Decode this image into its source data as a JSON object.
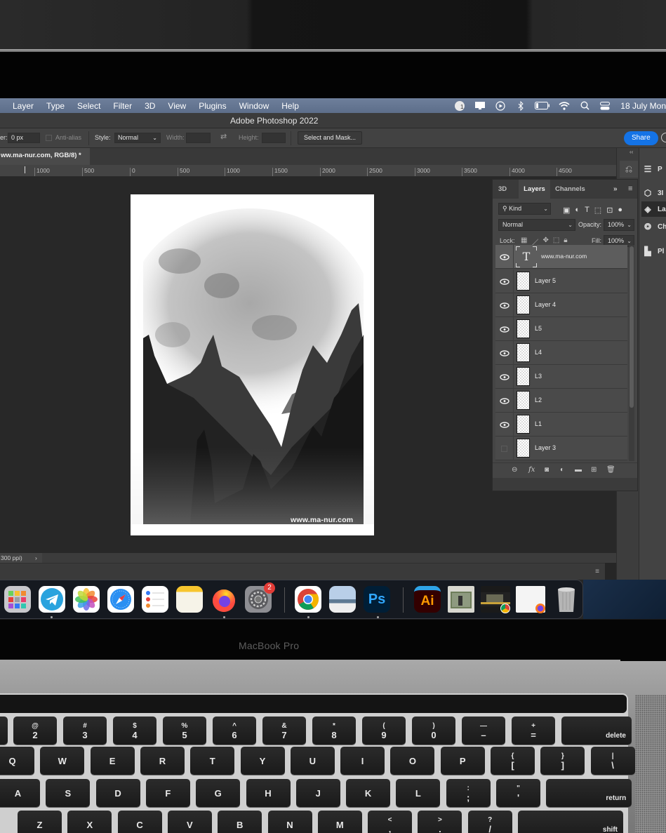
{
  "menubar": {
    "items": [
      "Layer",
      "Type",
      "Select",
      "Filter",
      "3D",
      "View",
      "Plugins",
      "Window",
      "Help"
    ],
    "status_icons": [
      "notification-badge-icon",
      "display-icon",
      "play-icon",
      "bluetooth-icon",
      "battery-icon",
      "wifi-icon",
      "search-icon",
      "control-center-icon"
    ],
    "notification_count": "1",
    "date": "18 July Mon"
  },
  "app": {
    "title": "Adobe Photoshop 2022"
  },
  "options_bar": {
    "feather_label": "er:",
    "feather_value": "0 px",
    "antialias_label": "Anti-alias",
    "style_label": "Style:",
    "style_value": "Normal",
    "width_label": "Width:",
    "height_label": "Height:",
    "select_mask_label": "Select and Mask...",
    "share_label": "Share"
  },
  "document_tab": {
    "label": "ww.ma-nur.com, RGB/8) *"
  },
  "ruler": {
    "ticks": [
      "1000",
      "500",
      "0",
      "500",
      "1000",
      "1500",
      "2000",
      "2500",
      "3000",
      "3500",
      "4000",
      "4500"
    ]
  },
  "canvas": {
    "watermark": "www.ma-nur.com"
  },
  "status_bar": {
    "text": "300 ppi)",
    "arrow": "›"
  },
  "right_dock": {
    "items": [
      {
        "label": "P",
        "icon": "properties-icon"
      },
      {
        "label": "3I",
        "icon": "3d-cube-icon"
      },
      {
        "label": "La",
        "icon": "layers-icon"
      },
      {
        "label": "Ch",
        "icon": "channels-icon"
      },
      {
        "label": "Pl",
        "icon": "plugins-icon"
      }
    ]
  },
  "layers_panel": {
    "tabs": [
      "3D",
      "Layers",
      "Channels"
    ],
    "active_tab": "Layers",
    "filter_kind": "Kind",
    "blend_mode": "Normal",
    "opacity_label": "Opacity:",
    "opacity_value": "100%",
    "lock_label": "Lock:",
    "fill_label": "Fill:",
    "fill_value": "100%",
    "layers": [
      {
        "name": "www.ma-nur.com",
        "type": "text",
        "visible": true,
        "selected": true
      },
      {
        "name": "Layer 5",
        "type": "pixel",
        "visible": true,
        "selected": false
      },
      {
        "name": "Layer 4",
        "type": "pixel",
        "visible": true,
        "selected": false
      },
      {
        "name": "L5",
        "type": "pixel",
        "visible": true,
        "selected": false
      },
      {
        "name": "L4",
        "type": "pixel",
        "visible": true,
        "selected": false
      },
      {
        "name": "L3",
        "type": "pixel",
        "visible": true,
        "selected": false
      },
      {
        "name": "L2",
        "type": "pixel",
        "visible": true,
        "selected": false
      },
      {
        "name": "L1",
        "type": "pixel",
        "visible": true,
        "selected": false
      },
      {
        "name": "Layer 3",
        "type": "pixel",
        "visible": false,
        "selected": false
      }
    ]
  },
  "dock": {
    "apps": [
      {
        "name": "Launchpad",
        "running": false
      },
      {
        "name": "Telegram",
        "running": true
      },
      {
        "name": "Photos",
        "running": false
      },
      {
        "name": "Safari",
        "running": false
      },
      {
        "name": "Reminders",
        "running": false
      },
      {
        "name": "Notes",
        "running": false
      },
      {
        "name": "Firefox",
        "running": true
      },
      {
        "name": "System Preferences",
        "running": false,
        "badge": "2"
      },
      {
        "name": "Chrome",
        "running": true
      },
      {
        "name": "Preview",
        "running": false
      },
      {
        "name": "Photoshop",
        "running": true
      },
      {
        "name": "Illustrator",
        "running": false
      },
      {
        "name": "Photos stack",
        "running": false
      },
      {
        "name": "Chrome window",
        "running": false
      },
      {
        "name": "Firefox window",
        "running": false
      },
      {
        "name": "Trash",
        "running": false
      }
    ],
    "ps_label": "Ps",
    "ai_label": "Ai"
  },
  "laptop": {
    "brand": "MacBook Pro",
    "keys": {
      "row1": [
        [
          "@",
          "2"
        ],
        [
          "#",
          "3"
        ],
        [
          "$",
          "4"
        ],
        [
          "%",
          "5"
        ],
        [
          "^",
          "6"
        ],
        [
          "&",
          "7"
        ],
        [
          "*",
          "8"
        ],
        [
          "(",
          "9"
        ],
        [
          ")",
          "0"
        ],
        [
          "—",
          "–"
        ],
        [
          "+",
          "="
        ]
      ],
      "delete": "delete",
      "row2": [
        "Q",
        "W",
        "E",
        "R",
        "T",
        "Y",
        "U",
        "I",
        "O",
        "P"
      ],
      "row2_extra": [
        [
          "{",
          "["
        ],
        [
          "}",
          "]"
        ],
        [
          "|",
          "\\"
        ]
      ],
      "row3": [
        "A",
        "S",
        "D",
        "F",
        "G",
        "H",
        "J",
        "K",
        "L"
      ],
      "row3_extra": [
        [
          ":",
          ";"
        ],
        [
          "\"",
          "'"
        ]
      ],
      "return": "return",
      "row4": [
        "Z",
        "X",
        "C",
        "V",
        "B",
        "N",
        "M"
      ],
      "row4_extra": [
        [
          "<",
          ","
        ],
        [
          ">",
          "."
        ],
        [
          "?",
          "/"
        ]
      ],
      "shift": "shift"
    }
  }
}
